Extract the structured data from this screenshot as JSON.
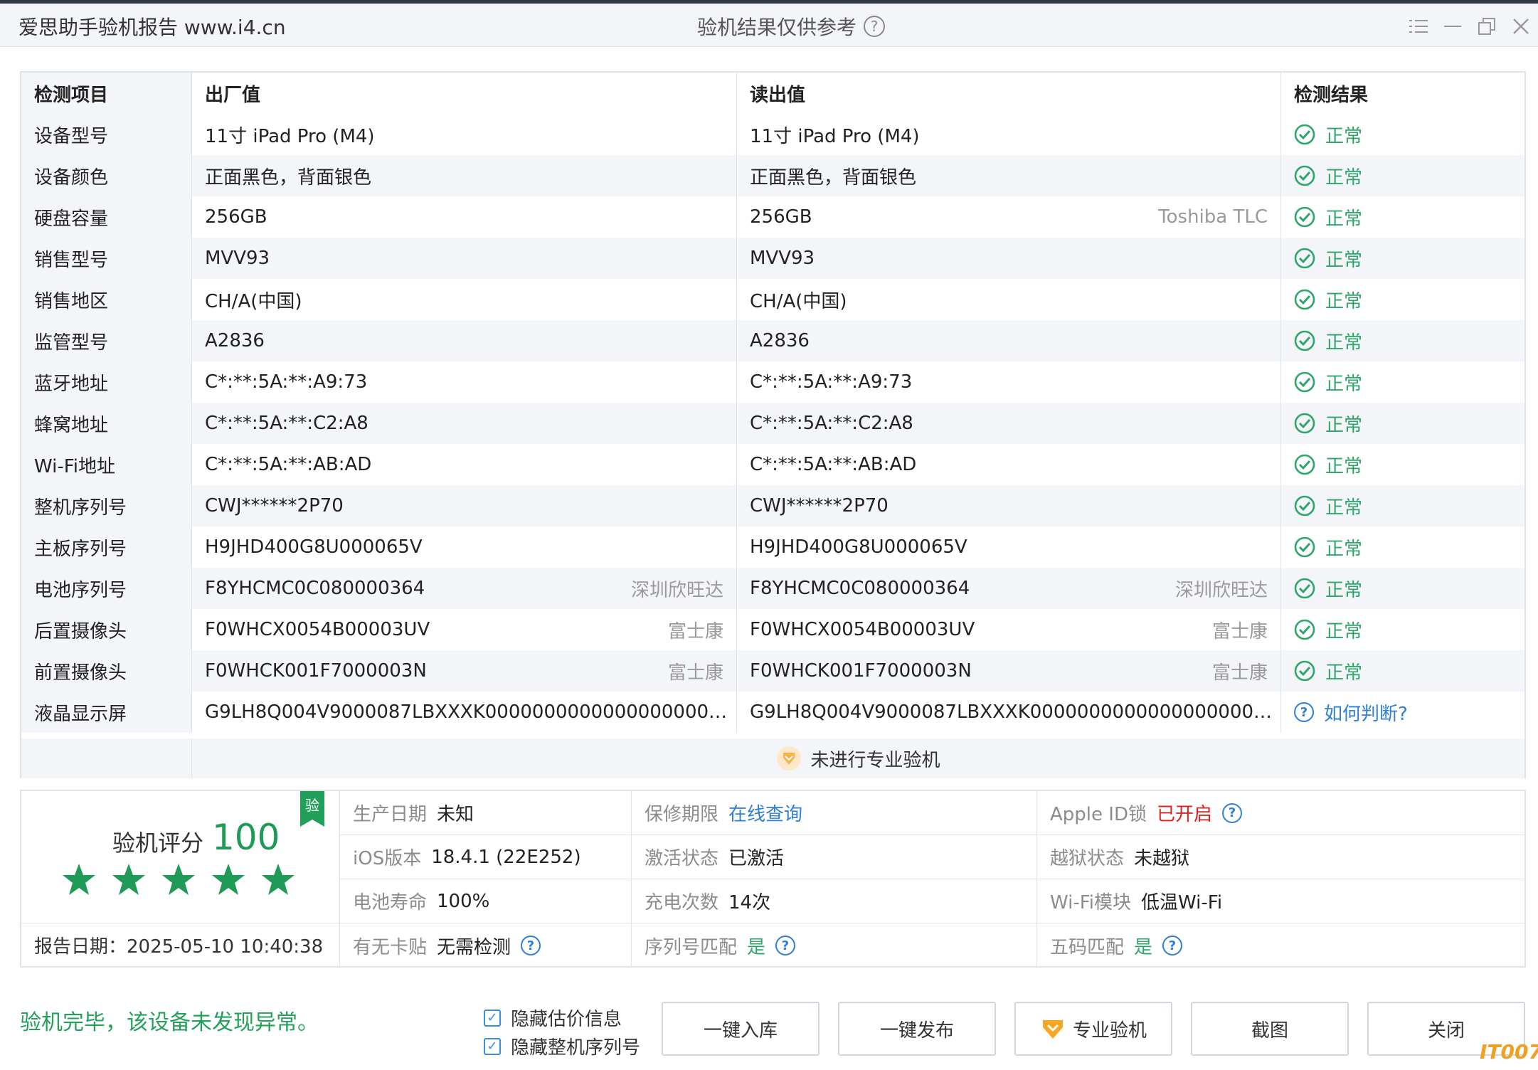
{
  "titlebar": {
    "app_title": "爱思助手验机报告 www.i4.cn",
    "center_title": "验机结果仅供参考",
    "help_glyph": "?"
  },
  "table": {
    "headers": [
      "检测项目",
      "出厂值",
      "读出值",
      "检测结果"
    ],
    "rows": [
      {
        "item": "设备型号",
        "factory": "11寸 iPad Pro (M4)",
        "factory_note": "",
        "read": "11寸 iPad Pro (M4)",
        "read_note": "",
        "result": "正常"
      },
      {
        "item": "设备颜色",
        "factory": "正面黑色，背面银色",
        "factory_note": "",
        "read": "正面黑色，背面银色",
        "read_note": "",
        "result": "正常"
      },
      {
        "item": "硬盘容量",
        "factory": "256GB",
        "factory_note": "",
        "read": "256GB",
        "read_note": "Toshiba TLC",
        "result": "正常"
      },
      {
        "item": "销售型号",
        "factory": "MVV93",
        "factory_note": "",
        "read": "MVV93",
        "read_note": "",
        "result": "正常"
      },
      {
        "item": "销售地区",
        "factory": "CH/A(中国)",
        "factory_note": "",
        "read": "CH/A(中国)",
        "read_note": "",
        "result": "正常"
      },
      {
        "item": "监管型号",
        "factory": "A2836",
        "factory_note": "",
        "read": "A2836",
        "read_note": "",
        "result": "正常"
      },
      {
        "item": "蓝牙地址",
        "factory": "C*:**:5A:**:A9:73",
        "factory_note": "",
        "read": "C*:**:5A:**:A9:73",
        "read_note": "",
        "result": "正常"
      },
      {
        "item": "蜂窝地址",
        "factory": "C*:**:5A:**:C2:A8",
        "factory_note": "",
        "read": "C*:**:5A:**:C2:A8",
        "read_note": "",
        "result": "正常"
      },
      {
        "item": "Wi-Fi地址",
        "factory": "C*:**:5A:**:AB:AD",
        "factory_note": "",
        "read": "C*:**:5A:**:AB:AD",
        "read_note": "",
        "result": "正常"
      },
      {
        "item": "整机序列号",
        "factory": "CWJ******2P70",
        "factory_note": "",
        "read": "CWJ******2P70",
        "read_note": "",
        "result": "正常"
      },
      {
        "item": "主板序列号",
        "factory": "H9JHD400G8U000065V",
        "factory_note": "",
        "read": "H9JHD400G8U000065V",
        "read_note": "",
        "result": "正常"
      },
      {
        "item": "电池序列号",
        "factory": "F8YHCMC0C080000364",
        "factory_note": "深圳欣旺达",
        "read": "F8YHCMC0C080000364",
        "read_note": "深圳欣旺达",
        "result": "正常"
      },
      {
        "item": "后置摄像头",
        "factory": "F0WHCX0054B00003UV",
        "factory_note": "富士康",
        "read": "F0WHCX0054B00003UV",
        "read_note": "富士康",
        "result": "正常"
      },
      {
        "item": "前置摄像头",
        "factory": "F0WHCK001F7000003N",
        "factory_note": "富士康",
        "read": "F0WHCK001F7000003N",
        "read_note": "富士康",
        "result": "正常"
      },
      {
        "item": "液晶显示屏",
        "factory": "G9LH8Q004V9000087LBXXXK000000000000000000000000000...",
        "factory_note": "",
        "read": "G9LH8Q004V9000087LBXXXK000000000000000000000000000...",
        "read_note": "",
        "result": "如何判断?"
      }
    ],
    "footer_text": "未进行专业验机"
  },
  "summary": {
    "score_label": "验机评分",
    "score_value": "100",
    "stars": 5,
    "badge": "验",
    "report_date": "报告日期：2025-05-10 10:40:38",
    "info": {
      "prod_date": {
        "k": "生产日期",
        "v": "未知"
      },
      "warranty": {
        "k": "保修期限",
        "v": "在线查询"
      },
      "appleid": {
        "k": "Apple ID锁",
        "v": "已开启"
      },
      "ios": {
        "k": "iOS版本",
        "v": "18.4.1 (22E252)"
      },
      "activation": {
        "k": "激活状态",
        "v": "已激活"
      },
      "jailbreak": {
        "k": "越狱状态",
        "v": "未越狱"
      },
      "battery": {
        "k": "电池寿命",
        "v": "100%"
      },
      "charge": {
        "k": "充电次数",
        "v": "14次"
      },
      "wifi": {
        "k": "Wi-Fi模块",
        "v": "低温Wi-Fi"
      },
      "sim": {
        "k": "有无卡贴",
        "v": "无需检测"
      },
      "serial_match": {
        "k": "序列号匹配",
        "v": "是"
      },
      "five_match": {
        "k": "五码匹配",
        "v": "是"
      }
    }
  },
  "bottom": {
    "status": "验机完毕，该设备未发现异常。",
    "hide_price": "隐藏估价信息",
    "hide_serial": "隐藏整机序列号",
    "buttons": {
      "import": "一键入库",
      "publish": "一键发布",
      "pro": "专业验机",
      "screenshot": "截图",
      "close": "关闭"
    },
    "watermark": "IT007"
  },
  "colors": {
    "accent_green": "#2ea66b",
    "link_blue": "#2f7fd6",
    "alert_red": "#e02020"
  }
}
